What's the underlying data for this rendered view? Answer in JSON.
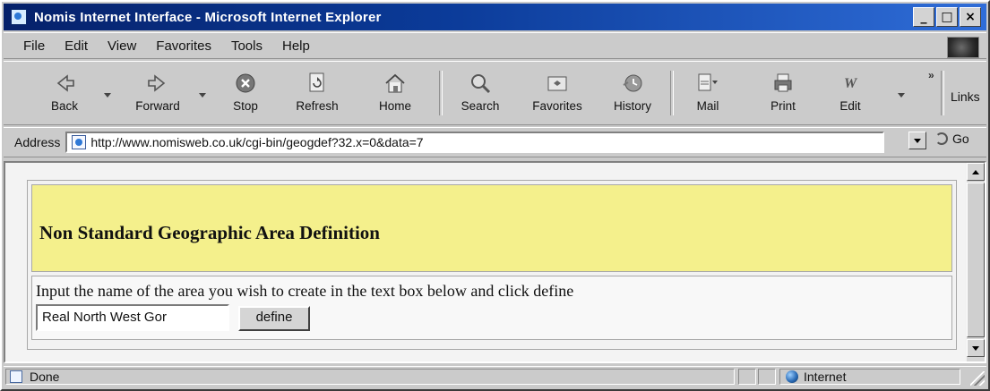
{
  "window": {
    "title": "Nomis Internet Interface - Microsoft Internet Explorer",
    "buttons": [
      "_",
      "□",
      "×"
    ]
  },
  "menu": {
    "items": [
      "File",
      "Edit",
      "View",
      "Favorites",
      "Tools",
      "Help"
    ]
  },
  "toolbar": {
    "buttons": [
      {
        "label": "Back",
        "icon": "back-arrow-icon"
      },
      {
        "label": "Forward",
        "icon": "forward-arrow-icon"
      },
      {
        "label": "Stop",
        "icon": "stop-icon"
      },
      {
        "label": "Refresh",
        "icon": "refresh-icon"
      },
      {
        "label": "Home",
        "icon": "home-icon"
      },
      {
        "label": "Search",
        "icon": "search-icon"
      },
      {
        "label": "Favorites",
        "icon": "favorites-icon"
      },
      {
        "label": "History",
        "icon": "history-icon"
      },
      {
        "label": "Mail",
        "icon": "mail-icon"
      },
      {
        "label": "Print",
        "icon": "print-icon"
      },
      {
        "label": "Edit",
        "icon": "edit-icon"
      }
    ],
    "overflow": "»",
    "links_label": "Links"
  },
  "address": {
    "label": "Address",
    "url": "http://www.nomisweb.co.uk/cgi-bin/geogdef?32.x=0&data=7",
    "go_label": "Go"
  },
  "page": {
    "banner_title": "Non Standard Geographic Area Definition",
    "instructions": "Input the name of the area you wish to create in the text box below and click define",
    "name_input_value": "Real North West Gor",
    "define_button": "define"
  },
  "status": {
    "text": "Done",
    "zone": "Internet"
  },
  "colors": {
    "title_bar": "#0b3b99",
    "banner": "#f4f08c"
  }
}
